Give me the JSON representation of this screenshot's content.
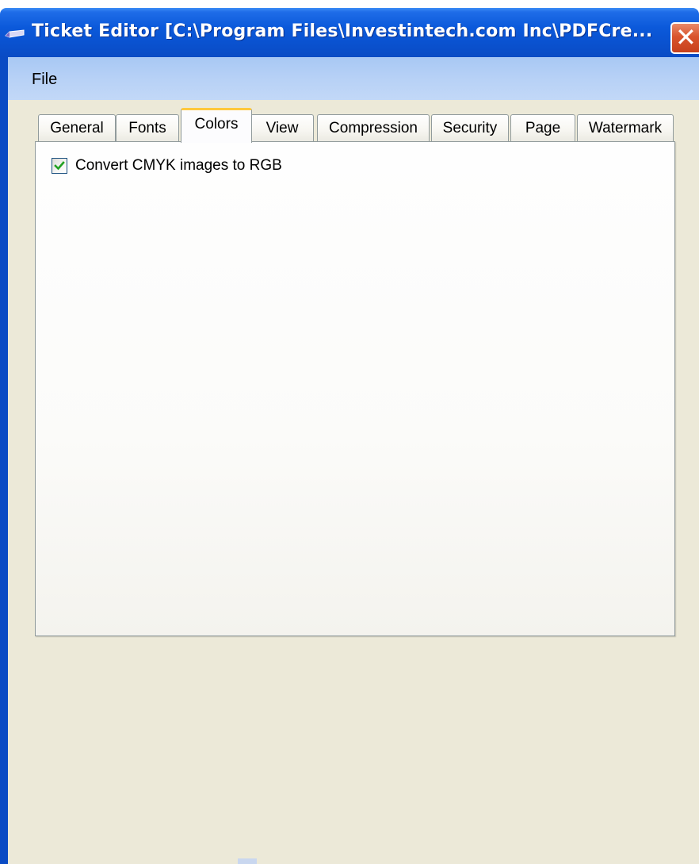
{
  "window": {
    "title": "Ticket Editor [C:\\Program Files\\Investintech.com Inc\\PDFCre...",
    "close_label": "✕"
  },
  "menu": {
    "file_label": "File"
  },
  "tabs": [
    {
      "label": "General",
      "selected": false
    },
    {
      "label": "Fonts",
      "selected": false
    },
    {
      "label": "Colors",
      "selected": true
    },
    {
      "label": "View",
      "selected": false
    },
    {
      "label": "Compression",
      "selected": false
    },
    {
      "label": "Security",
      "selected": false
    },
    {
      "label": "Page",
      "selected": false
    },
    {
      "label": "Watermark",
      "selected": false
    }
  ],
  "colors_panel": {
    "convert_cmyk_label": "Convert CMYK images to RGB",
    "convert_cmyk_checked": true
  },
  "theme": {
    "titlebar": "#0a52d0",
    "menubar": "#b7d1f6",
    "client": "#ece9d8",
    "selected_tab_accent": "#ffc83c",
    "check_mark": "#21a121"
  }
}
